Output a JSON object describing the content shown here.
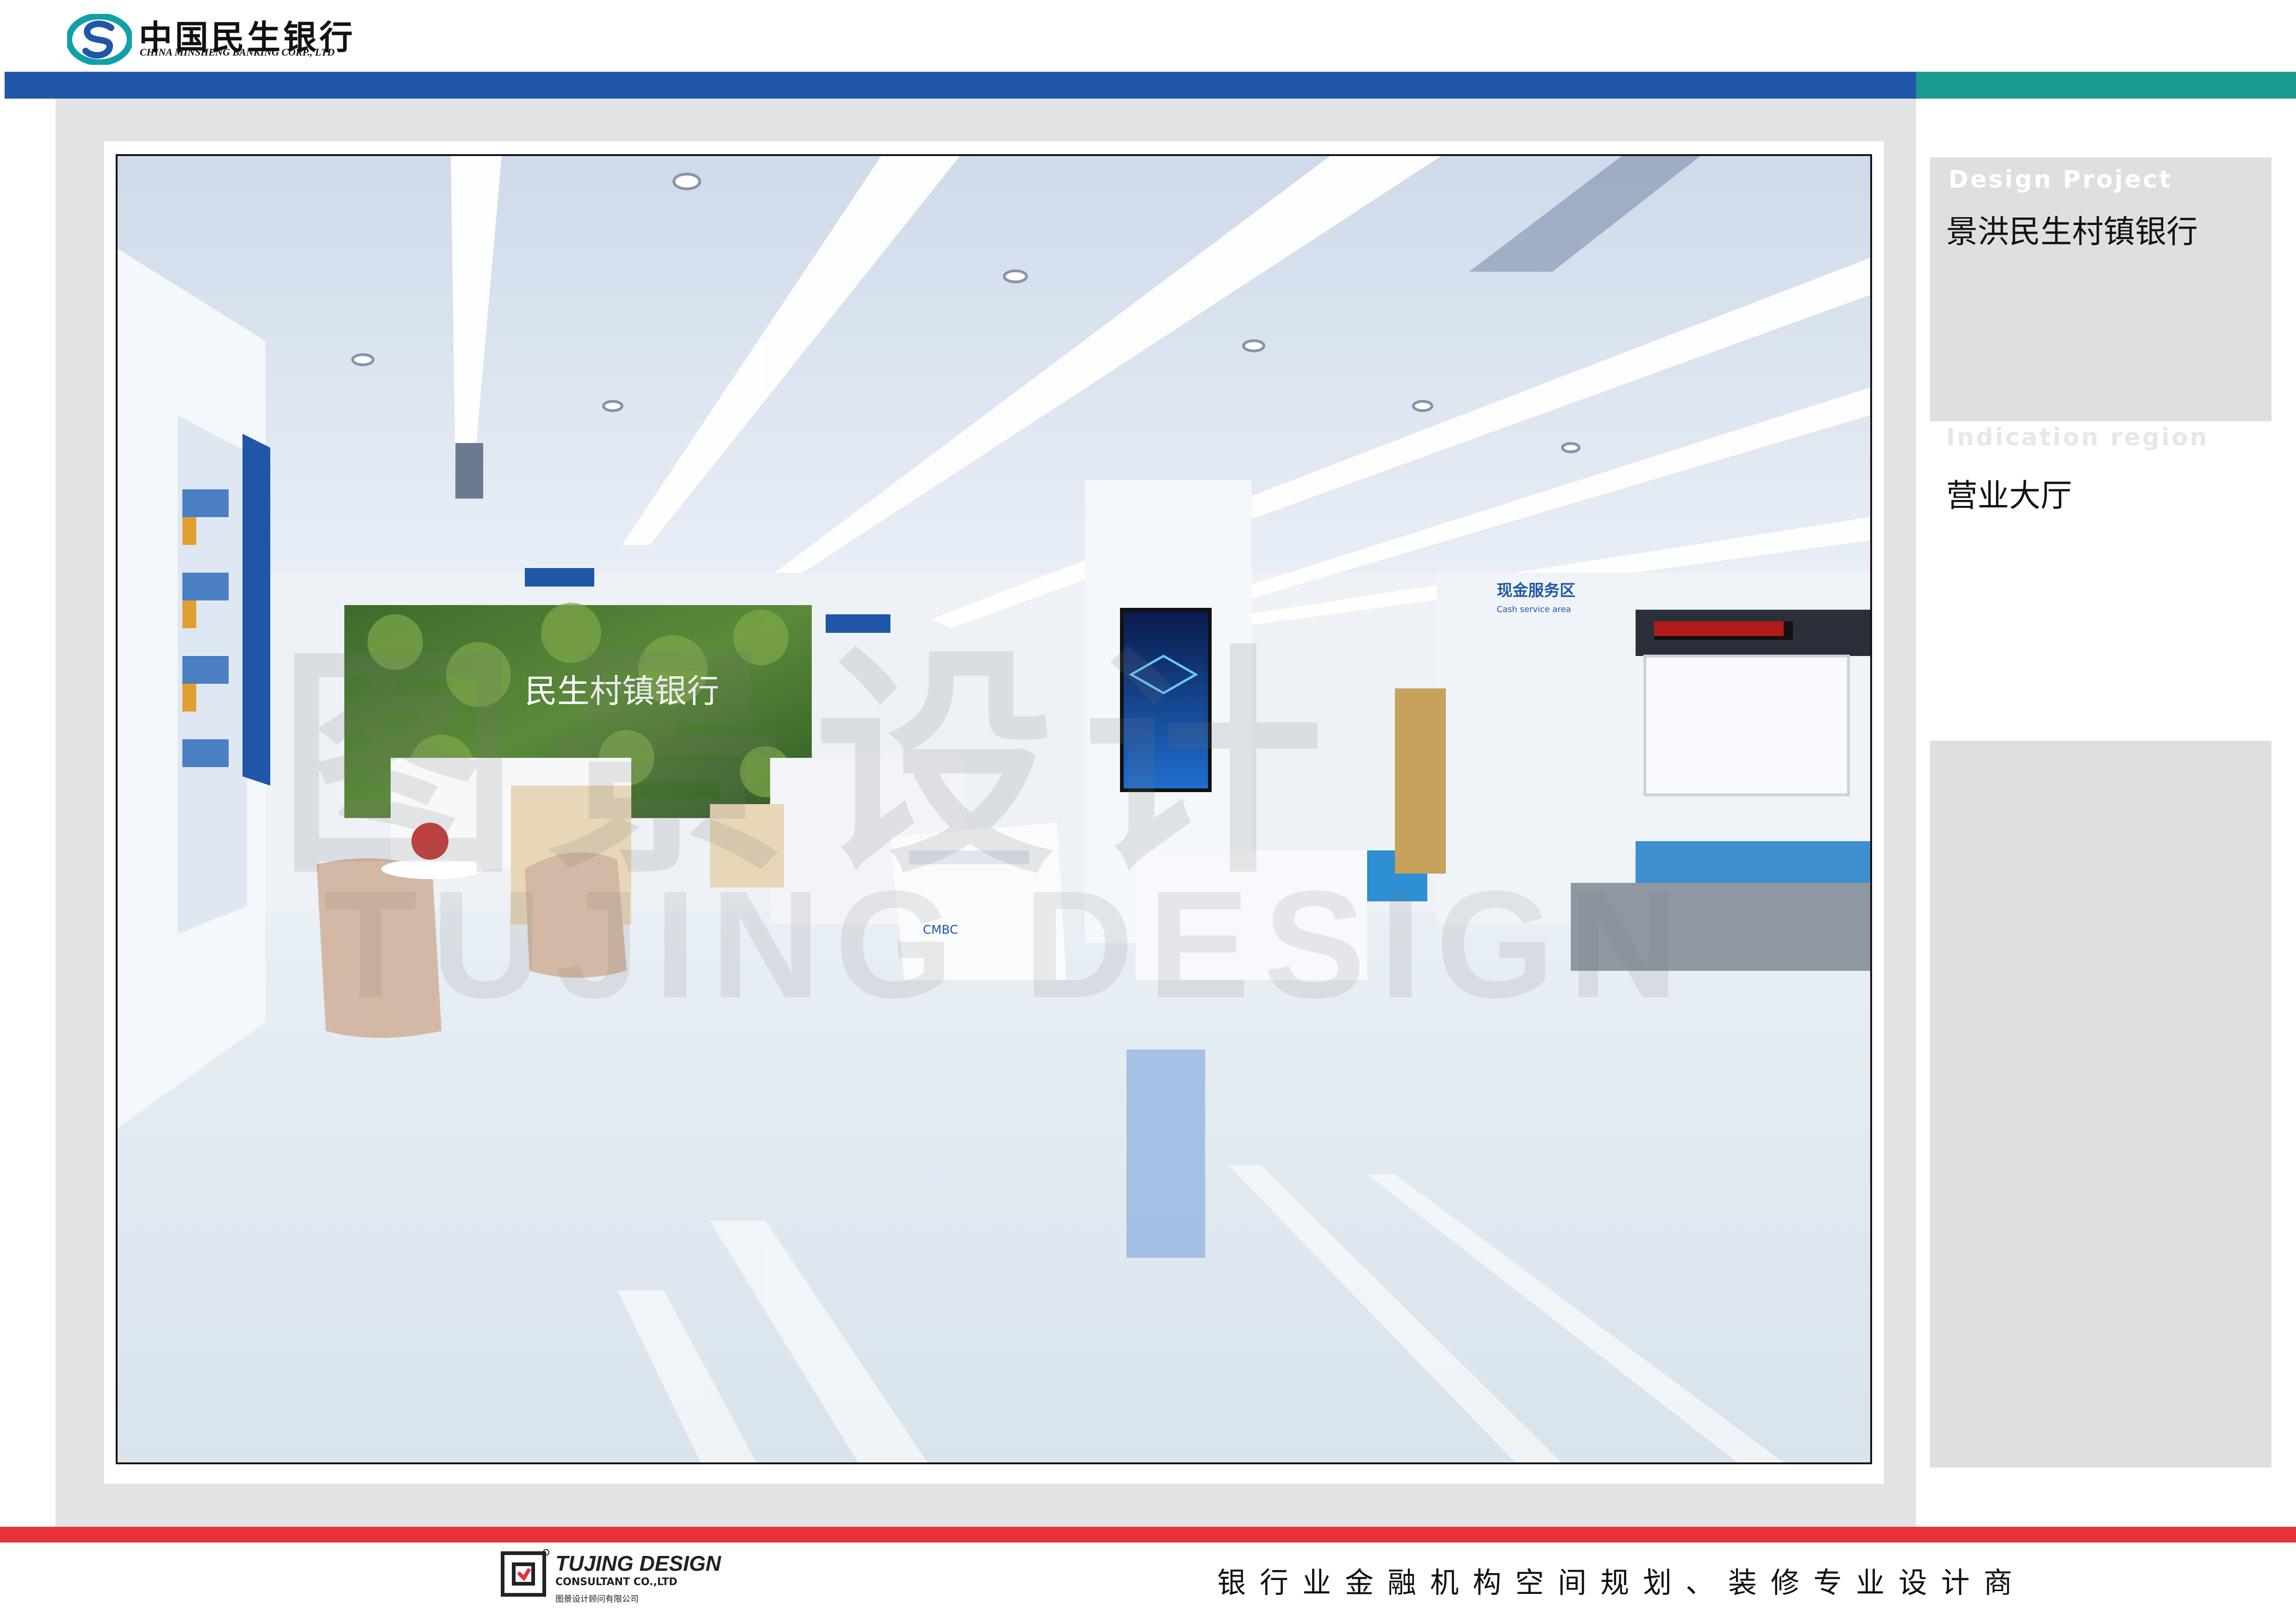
{
  "header": {
    "brand_cn": "中国民生银行",
    "brand_en": "CHINA MINSHENG BANKING CORP., LTD",
    "logo_icon": "minsheng-logo-icon"
  },
  "colors": {
    "header_blue": "#1f56a8",
    "header_teal": "#1a9a8f",
    "footer_red": "#e63238",
    "frame_grey": "#e2e3e5",
    "panel_grey": "#dedfe1"
  },
  "panel": {
    "design_project_label": "Design Project",
    "design_project_value": "景洪民生村镇银行",
    "indication_label": "Indication region",
    "indication_value": "营业大厅"
  },
  "render": {
    "sign_cash": "现金服务区",
    "sign_cash_en": "Cash service area",
    "wall_brand": "民生村镇银行",
    "watermark_cn": "图景设计",
    "watermark_en": "TUJING DESIGN"
  },
  "footer": {
    "brand": "TUJING DESIGN",
    "brand_sub": "CONSULTANT CO.,LTD",
    "brand_cn": "图景设计顾问有限公司",
    "tagline": "银行业金融机构空间规划、装修专业设计商",
    "logo_icon": "tujing-logo-icon"
  }
}
